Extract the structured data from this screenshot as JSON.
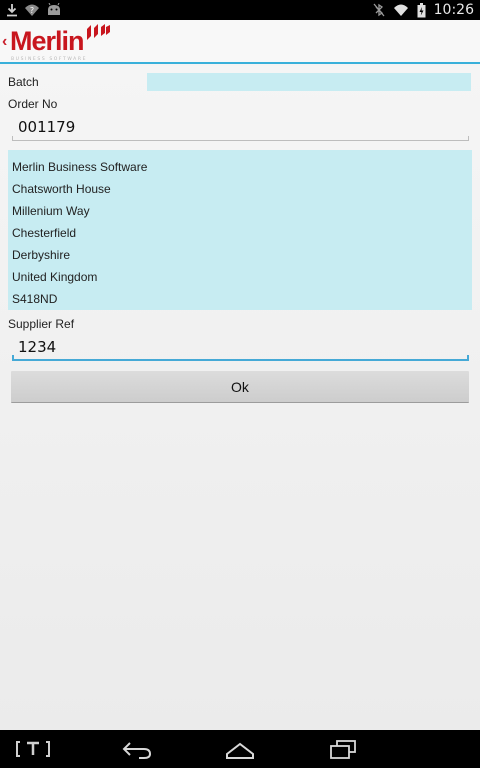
{
  "status_bar": {
    "time": "10:26",
    "left_icons": [
      "download-icon",
      "wifi-question-icon",
      "android-icon"
    ],
    "right_icons": [
      "bluetooth-off-icon",
      "wifi-icon",
      "battery-charging-icon"
    ]
  },
  "app_bar": {
    "logo_text": "Merlin",
    "logo_subtitle": "BUSINESS SOFTWARE",
    "up_icon": "chevron-left-icon"
  },
  "form": {
    "batch_label": "Batch",
    "batch_value": "",
    "order_no_label": "Order No",
    "order_no_value": "001179",
    "address_lines": [
      "Merlin Business Software",
      "Chatsworth House",
      "Millenium Way",
      "Chesterfield",
      "Derbyshire",
      "United Kingdom",
      "S418ND"
    ],
    "supplier_ref_label": "Supplier Ref",
    "supplier_ref_value": "1234",
    "ok_label": "Ok"
  },
  "nav_bar": {
    "icons": [
      "keyboard-bracket-icon",
      "back-icon",
      "home-icon",
      "recent-apps-icon"
    ]
  },
  "colors": {
    "brand_red": "#c8161e",
    "field_highlight": "#c7ecf2",
    "focus_blue": "#45a9d6"
  }
}
